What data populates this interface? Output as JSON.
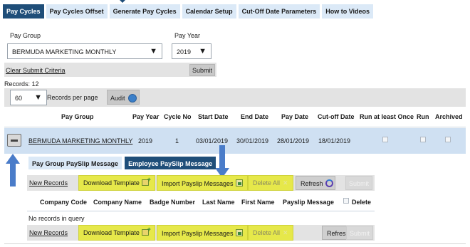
{
  "tabs": [
    {
      "label": "Pay Cycles",
      "active": true
    },
    {
      "label": "Pay Cycles Offset"
    },
    {
      "label": "Generate Pay Cycles"
    },
    {
      "label": "Calendar Setup"
    },
    {
      "label": "Cut-Off Date Parameters"
    },
    {
      "label": "How to Videos"
    }
  ],
  "filters": {
    "pay_group_label": "Pay Group",
    "pay_group_value": "BERMUDA MARKETING MONTHLY",
    "pay_year_label": "Pay Year",
    "pay_year_value": "2019"
  },
  "criteria": {
    "clear_label": "Clear Submit Criteria",
    "submit_label": "Submit"
  },
  "records": {
    "count_text": "Records: 12",
    "per_page_value": "60",
    "per_page_label": "Records per page",
    "audit_label": "Audit"
  },
  "table": {
    "columns": [
      "Pay Group",
      "Pay Year",
      "Cycle No",
      "Start Date",
      "End Date",
      "Pay Date",
      "Cut-off Date",
      "Run at least Once",
      "Run",
      "Archived"
    ],
    "rows": [
      {
        "pay_group": "BERMUDA MARKETING MONTHLY",
        "pay_year": "2019",
        "cycle_no": "1",
        "start_date": "03/01/2019",
        "end_date": "30/01/2019",
        "pay_date": "28/01/2019",
        "cutoff_date": "18/01/2019"
      }
    ]
  },
  "subtabs": [
    {
      "label": "Pay Group PaySlip Message"
    },
    {
      "label": "Employee PaySlip Message",
      "active": true
    }
  ],
  "actions": {
    "new_records": "New Records",
    "download_template": "Download Template",
    "import_messages": "Import Payslip Messages",
    "delete_all": "Delete All",
    "refresh": "Refresh",
    "submit": "Submit"
  },
  "messages_table": {
    "columns": [
      "Company Code",
      "Company Name",
      "Badge Number",
      "Last Name",
      "First Name",
      "Payslip Message",
      "Delete"
    ],
    "empty_text": "No records in query"
  },
  "colors": {
    "tab_active": "#1f4e79",
    "tab_inactive": "#dbe9f7",
    "highlight": "#e6e84a",
    "row_selected": "#cfe0f2",
    "annotation_arrow": "#4a7cc9"
  }
}
